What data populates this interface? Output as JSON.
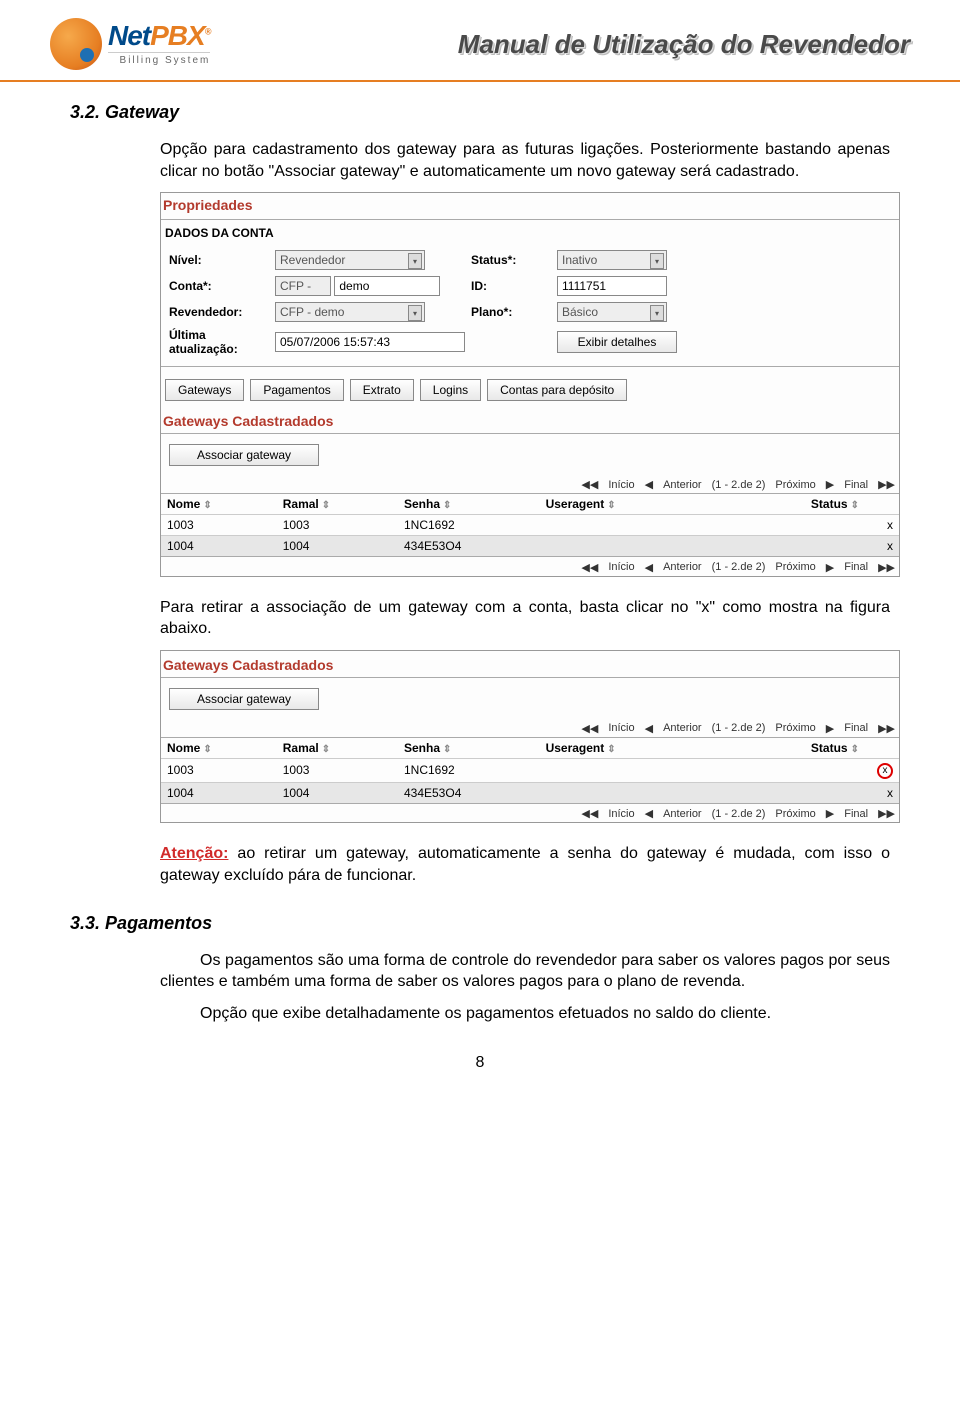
{
  "header": {
    "logo_main": "NetPBX",
    "logo_net": "Net",
    "logo_pbx": "PBX",
    "logo_sub": "Billing System",
    "logo_reg": "®",
    "title": "Manual de Utilização do Revendedor"
  },
  "sections": {
    "gateway": {
      "number": "3.2.",
      "title": "Gateway",
      "para1": "Opção para cadastramento dos gateway para as futuras ligações. Posteriormente bastando apenas clicar no botão \"Associar gateway\" e automaticamente um novo gateway será cadastrado.",
      "para2": "Para retirar a associação de um gateway com a conta, basta clicar no \"x\" como mostra na figura abaixo.",
      "atencao_label": "Atenção:",
      "atencao_text": " ao retirar um gateway, automaticamente a senha do gateway é mudada, com isso o gateway excluído pára de funcionar."
    },
    "pagamentos": {
      "number": "3.3.",
      "title": "Pagamentos",
      "para1": "Os pagamentos são uma forma de controle do revendedor para saber os valores pagos por seus clientes e também uma forma de saber os valores pagos para o plano de revenda.",
      "para2": "Opção que exibe detalhadamente os pagamentos efetuados no saldo do cliente."
    }
  },
  "ui": {
    "propriedades": {
      "title": "Propriedades",
      "dados_title": "DADOS DA CONTA",
      "labels": {
        "nivel": "Nível:",
        "status": "Status*:",
        "conta": "Conta*:",
        "id": "ID:",
        "revendedor": "Revendedor:",
        "plano": "Plano*:",
        "ultima": "Última\natualização:"
      },
      "values": {
        "nivel": "Revendedor",
        "status": "Inativo",
        "conta_prefix": "CFP -",
        "conta": "demo",
        "id": "1111751",
        "revendedor": "CFP - demo",
        "plano": "Básico",
        "ultima": "05/07/2006 15:57:43",
        "exibir": "Exibir detalhes"
      },
      "tabs": [
        "Gateways",
        "Pagamentos",
        "Extrato",
        "Logins",
        "Contas para depósito"
      ]
    },
    "gateways": {
      "title": "Gateways Cadastradados",
      "assoc_btn": "Associar gateway",
      "nav": {
        "inicio": "Início",
        "anterior": "Anterior",
        "range": "(1 - 2.de 2)",
        "proximo": "Próximo",
        "final": "Final"
      },
      "headers": [
        "Nome",
        "Ramal",
        "Senha",
        "Useragent",
        "Status"
      ],
      "rows": [
        {
          "nome": "1003",
          "ramal": "1003",
          "senha": "1NC1692",
          "useragent": "",
          "status": "",
          "x": "x"
        },
        {
          "nome": "1004",
          "ramal": "1004",
          "senha": "434E53O4",
          "useragent": "",
          "status": "",
          "x": "x"
        }
      ]
    }
  },
  "chart_data": {
    "type": "table",
    "title": "Gateways Cadastradados",
    "columns": [
      "Nome",
      "Ramal",
      "Senha",
      "Useragent",
      "Status"
    ],
    "rows": [
      [
        "1003",
        "1003",
        "1NC1692",
        "",
        ""
      ],
      [
        "1004",
        "1004",
        "434E53O4",
        "",
        ""
      ]
    ]
  },
  "page_number": "8"
}
